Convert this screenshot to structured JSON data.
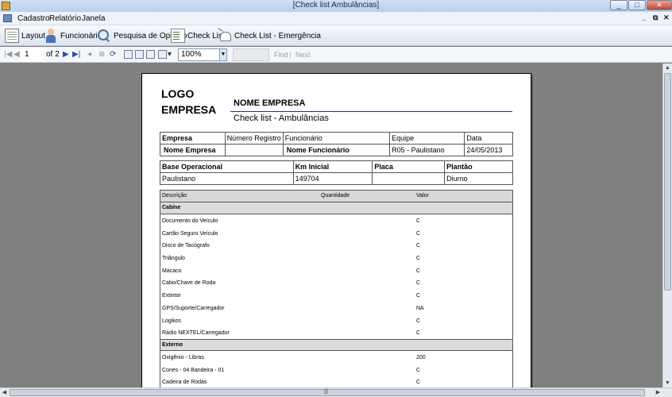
{
  "window": {
    "title": "[Check list Ambulâncias]",
    "controls": [
      "_",
      "□",
      "✕"
    ]
  },
  "menu": {
    "items": [
      "Cadastro",
      "Relatório",
      "Janela"
    ],
    "mdi_controls": [
      "_",
      "⧉",
      "✕"
    ]
  },
  "toolbar": {
    "buttons": [
      {
        "label": "Layout",
        "icon": "layout-icon"
      },
      {
        "label": "Funcionário",
        "icon": "person-icon"
      },
      {
        "label": "Pesquisa de Opinião",
        "icon": "search-icon"
      },
      {
        "label": "Check List",
        "icon": "checklist-icon"
      },
      {
        "label": "Check List - Emergência",
        "icon": "ambulance-icon"
      }
    ]
  },
  "report_nav": {
    "page_current": "1",
    "page_of": "of 2",
    "zoom": "100%",
    "find_label": "Find",
    "next_label": "Next",
    "separator": "|"
  },
  "report": {
    "logo_line1": "LOGO",
    "logo_line2": "EMPRESA",
    "company_name": "NOME EMPRESA",
    "subtitle": "Check list - Ambulâncias",
    "info1": {
      "headers": [
        "Empresa",
        "Número Registro",
        "Funcionário",
        "Equipe",
        "Data"
      ],
      "values": [
        "Nome Empresa",
        "",
        "Nome Funcionário",
        "R05 - Paulistano",
        "24/05/2013"
      ]
    },
    "info2": {
      "headers": [
        "Base Operacional",
        "Km Inicial",
        "Placa",
        "Plantão"
      ],
      "values": [
        "Paulistano",
        "149704",
        "",
        "Diurno"
      ]
    },
    "items_header": [
      "Descrição",
      "Quantidade",
      "Valor"
    ],
    "sections": [
      {
        "name": "Cabine",
        "rows": [
          {
            "desc": "Documento do Veículo",
            "value": "C"
          },
          {
            "desc": "Cartão Seguro Veículo",
            "value": "C"
          },
          {
            "desc": "Disco de Tacógrafo",
            "value": "C"
          },
          {
            "desc": "Triângulo",
            "value": "C"
          },
          {
            "desc": "Macaco",
            "value": "C"
          },
          {
            "desc": "Cabo/Chave de Roda",
            "value": "C"
          },
          {
            "desc": "Extintor",
            "value": "C"
          },
          {
            "desc": "GPS/Suporte/Carregador",
            "value": "NA"
          },
          {
            "desc": "Logikos",
            "value": "C"
          },
          {
            "desc": "Rádio NEXTEL/Carregador",
            "value": "C"
          }
        ]
      },
      {
        "name": "Externo",
        "rows": [
          {
            "desc": "Oxigênio - Libras",
            "value": "200"
          },
          {
            "desc": "Cones - 04 Bandeira - 01",
            "value": "C"
          },
          {
            "desc": "Cadeira de Rodas",
            "value": "C"
          }
        ]
      }
    ]
  }
}
